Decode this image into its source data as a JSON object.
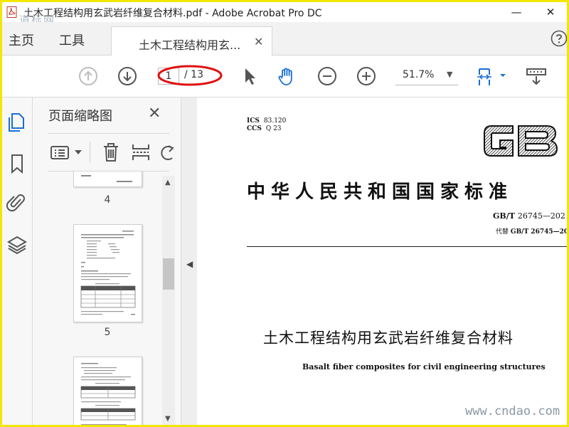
{
  "window": {
    "title": "土木工程结构用玄武岩纤维复合材料.pdf - Adobe Acrobat Pro DC",
    "watermark_top": "道标网",
    "minimize_label": "—",
    "close_label": "✕"
  },
  "menu": {
    "home": "主页",
    "tools": "工具"
  },
  "tab": {
    "label": "土木工程结构用玄...",
    "close": "✕"
  },
  "toolbar": {
    "page_current": "1",
    "page_total": "/ 13",
    "zoom": "51.7%",
    "zoom_arrow": "▼"
  },
  "panel": {
    "title": "页面缩略图",
    "close": "✕",
    "thumbnails": [
      {
        "label": "4"
      },
      {
        "label": "5"
      }
    ],
    "scroll_up": "▲",
    "scroll_down": "▼"
  },
  "collapse": {
    "arrow": "◀"
  },
  "document": {
    "ics_label": "ICS",
    "ics_value": "83.120",
    "ccs_label": "CCS",
    "ccs_value": "Q 23",
    "logo_text": "GB",
    "standard_title": "中华人民共和国国家标准",
    "standard_code": "GB/T",
    "standard_number": "26745—202",
    "replaces_label": "代替",
    "replaces_code": "GB/T 26745—20",
    "title_cn": "土木工程结构用玄武岩纤维复合材料",
    "title_en": "Basalt fiber composites for civil engineering structures"
  },
  "watermark_bottom": "www.cndao.com",
  "colors": {
    "frame": "#f3e600",
    "annotation": "#e01010",
    "icon_blue": "#1a6fd6",
    "icon_gray": "#666666"
  }
}
